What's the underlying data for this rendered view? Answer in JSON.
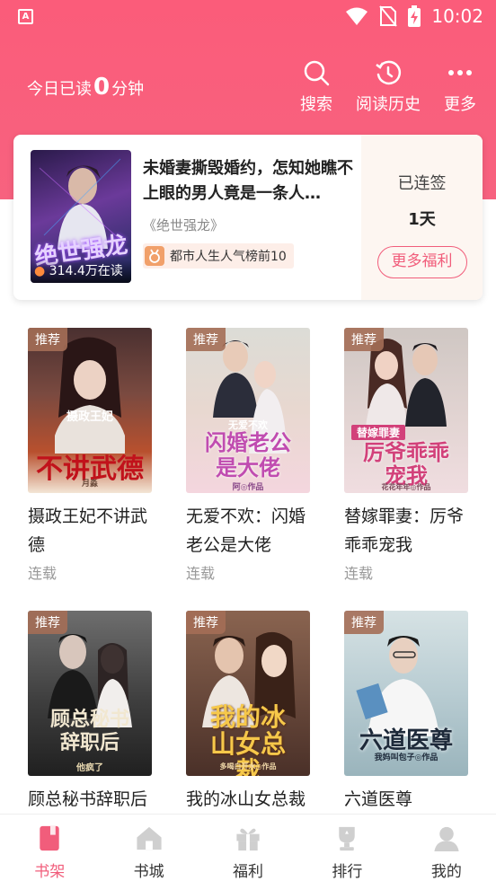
{
  "status_bar": {
    "app_icon": "A",
    "time": "10:02",
    "icons": [
      "wifi-icon",
      "no-sim-icon",
      "battery-charging-icon"
    ]
  },
  "header": {
    "read_prefix": "今日已读",
    "read_minutes": "0",
    "read_suffix": "分钟",
    "actions": [
      {
        "label": "搜索",
        "icon": "search-icon"
      },
      {
        "label": "阅读历史",
        "icon": "history-icon"
      },
      {
        "label": "更多",
        "icon": "more-icon"
      }
    ]
  },
  "daily": {
    "cover_title": "绝世强龙",
    "readers": "314.4万在读",
    "title": "未婚妻撕毁婚约，怎知她瞧不上眼的男人竟是一条人…",
    "book_name": "《绝世强龙》",
    "rank_text": "都市人生人气榜前10",
    "signed_label": "已连签",
    "signed_days": "1天",
    "more_welfare": "更多福利"
  },
  "books": [
    {
      "tag": "推荐",
      "cover_top": "摄政王妃",
      "cover_main": "不讲武德",
      "cover_author": "月淼",
      "title": "摄政王妃不讲武德",
      "status": "连载"
    },
    {
      "tag": "推荐",
      "cover_top": "无爱不欢",
      "cover_main": "闪婚老公是大佬",
      "cover_author": "阿◎作品",
      "title": "无爱不欢：闪婚老公是大佬",
      "status": "连载"
    },
    {
      "tag": "推荐",
      "cover_top": "替嫁罪妻",
      "cover_main": "厉爷乖乖宠我",
      "cover_author": "花花年年◎作品",
      "title": "替嫁罪妻：厉爷乖乖宠我",
      "status": "连载"
    },
    {
      "tag": "推荐",
      "cover_top": "",
      "cover_main": "顾总秘书辞职后",
      "cover_author": "他疯了",
      "title": "顾总秘书辞职后他疯了",
      "status": ""
    },
    {
      "tag": "推荐",
      "cover_top": "",
      "cover_main": "我的冰山女总裁",
      "cover_author": "多喝白开水◎作品",
      "title": "我的冰山女总裁",
      "status": ""
    },
    {
      "tag": "推荐",
      "cover_top": "",
      "cover_main": "六道医尊",
      "cover_author": "我妈叫包子◎作品",
      "title": "六道医尊",
      "status": ""
    }
  ],
  "bottom_nav": [
    {
      "label": "书架",
      "icon": "bookshelf-icon",
      "active": true
    },
    {
      "label": "书城",
      "icon": "bookstore-icon",
      "active": false
    },
    {
      "label": "福利",
      "icon": "gift-icon",
      "active": false
    },
    {
      "label": "排行",
      "icon": "trophy-icon",
      "active": false
    },
    {
      "label": "我的",
      "icon": "profile-icon",
      "active": false
    }
  ],
  "colors": {
    "accent": "#f15d7b",
    "header": "#fb5c7a"
  }
}
